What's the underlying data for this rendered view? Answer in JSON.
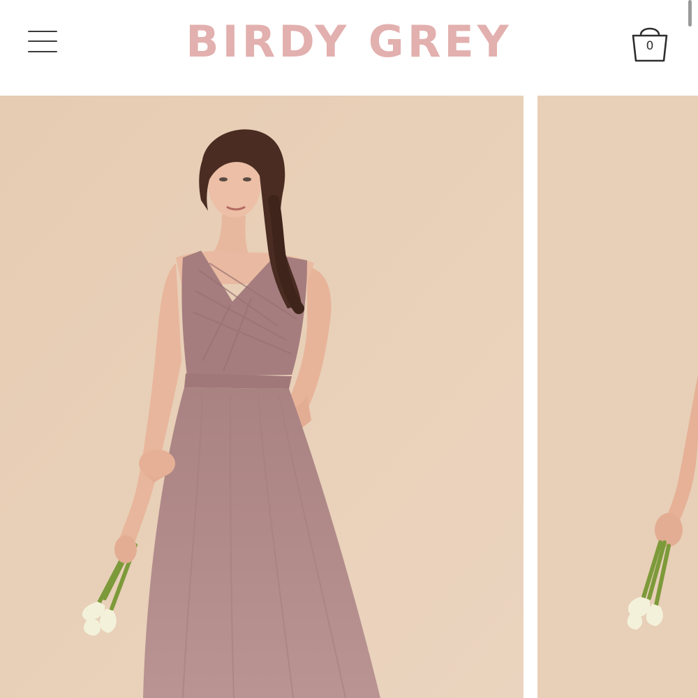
{
  "header": {
    "brand": "BIRDY GREY",
    "cart_count": "0",
    "menu_icon": "hamburger-menu-icon",
    "cart_icon": "shopping-bag-icon"
  },
  "carousel": {
    "slides": [
      {
        "subject": "model-in-mauve-tulle-gown",
        "backdrop": "#e8cfb8"
      },
      {
        "subject": "model-in-mauve-tulle-gown-partial",
        "backdrop": "#e8cfb8"
      }
    ]
  },
  "colors": {
    "brand_pink": "#e2b0ae",
    "backdrop": "#e8cfb8",
    "dress": "#b48b88",
    "icon": "#3a3a3a"
  }
}
